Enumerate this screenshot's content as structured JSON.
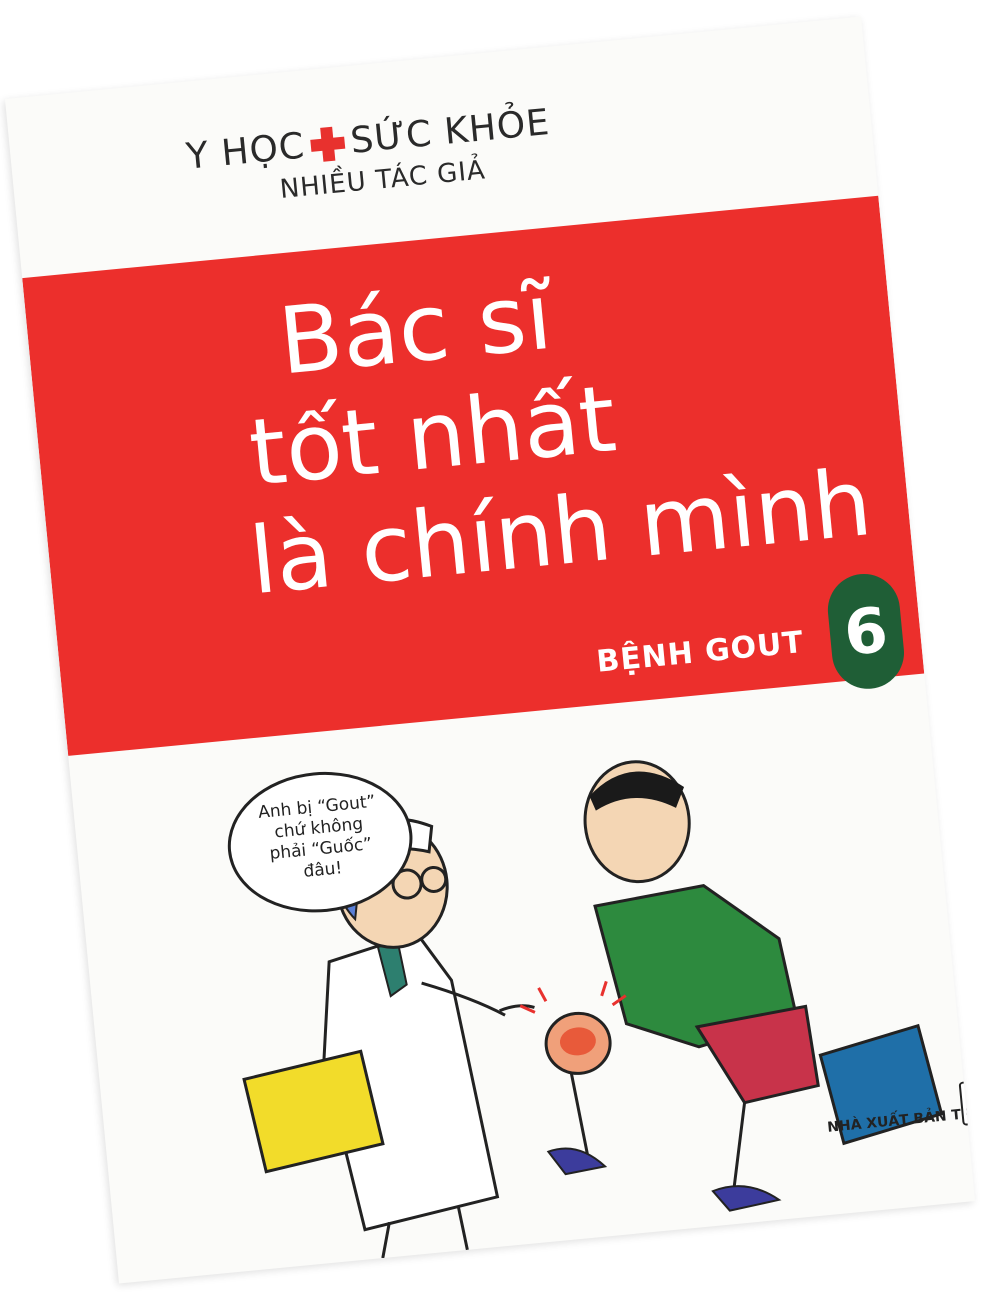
{
  "cover": {
    "series": {
      "left": "Y HỌC",
      "right": "SỨC KHỎE"
    },
    "author": "NHIỀU TÁC GIẢ",
    "title": {
      "line1": "Bác sĩ",
      "line2": "tốt nhất",
      "line3": "là chính mình"
    },
    "volume": "6",
    "subtitle": "BỆNH GOUT",
    "speech_bubble": {
      "line1": "Anh bị “Gout”",
      "line2": "chứ không",
      "line3": "phải “Guốc”",
      "line4": "đâu!"
    },
    "publisher": "NHÀ XUẤT BẢN TRẺ",
    "publisher_logo": "T",
    "colors": {
      "red_band": "#ec2f2c",
      "volume_badge": "#1f5e36",
      "cross": "#e8312e",
      "shirt": "#2d8a3e",
      "shorts": "#c8334a",
      "folder": "#f2dc2a"
    }
  }
}
